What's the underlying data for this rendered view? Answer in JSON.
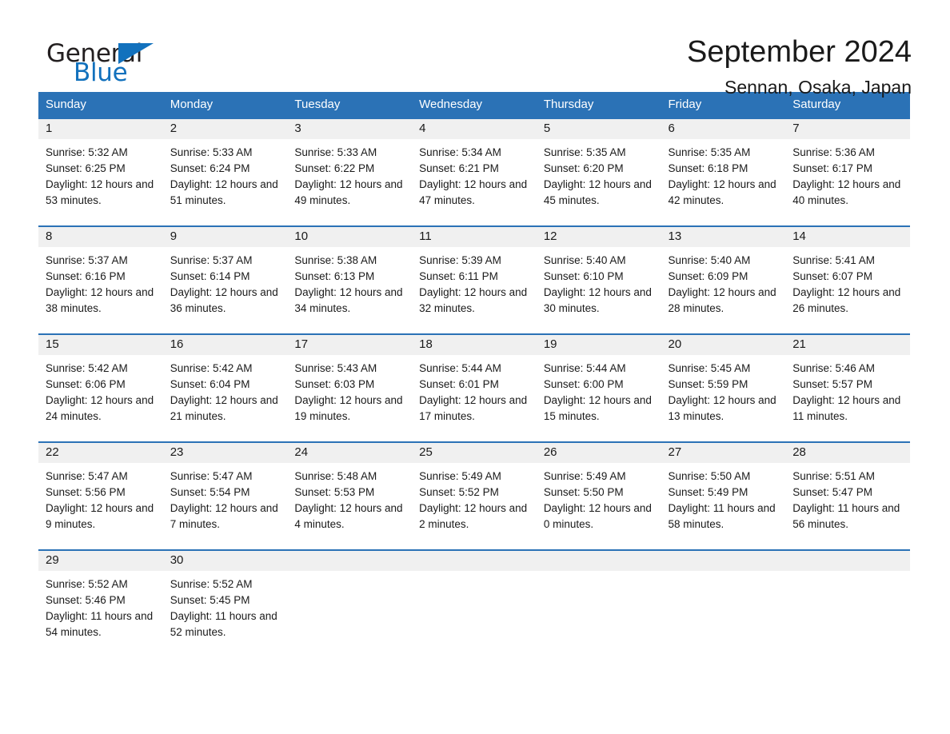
{
  "brand": {
    "name_part1": "General",
    "name_part2": "Blue",
    "triangle_color": "#1271bd"
  },
  "header": {
    "title": "September 2024",
    "subtitle": "Sennan, Osaka, Japan",
    "accent_color": "#2b72b6",
    "day_strip_color": "#f0f0f0"
  },
  "calendar": {
    "weekday_headers": [
      "Sunday",
      "Monday",
      "Tuesday",
      "Wednesday",
      "Thursday",
      "Friday",
      "Saturday"
    ],
    "weeks": [
      [
        {
          "day": "1",
          "sunrise": "Sunrise: 5:32 AM",
          "sunset": "Sunset: 6:25 PM",
          "daylight": "Daylight: 12 hours and 53 minutes."
        },
        {
          "day": "2",
          "sunrise": "Sunrise: 5:33 AM",
          "sunset": "Sunset: 6:24 PM",
          "daylight": "Daylight: 12 hours and 51 minutes."
        },
        {
          "day": "3",
          "sunrise": "Sunrise: 5:33 AM",
          "sunset": "Sunset: 6:22 PM",
          "daylight": "Daylight: 12 hours and 49 minutes."
        },
        {
          "day": "4",
          "sunrise": "Sunrise: 5:34 AM",
          "sunset": "Sunset: 6:21 PM",
          "daylight": "Daylight: 12 hours and 47 minutes."
        },
        {
          "day": "5",
          "sunrise": "Sunrise: 5:35 AM",
          "sunset": "Sunset: 6:20 PM",
          "daylight": "Daylight: 12 hours and 45 minutes."
        },
        {
          "day": "6",
          "sunrise": "Sunrise: 5:35 AM",
          "sunset": "Sunset: 6:18 PM",
          "daylight": "Daylight: 12 hours and 42 minutes."
        },
        {
          "day": "7",
          "sunrise": "Sunrise: 5:36 AM",
          "sunset": "Sunset: 6:17 PM",
          "daylight": "Daylight: 12 hours and 40 minutes."
        }
      ],
      [
        {
          "day": "8",
          "sunrise": "Sunrise: 5:37 AM",
          "sunset": "Sunset: 6:16 PM",
          "daylight": "Daylight: 12 hours and 38 minutes."
        },
        {
          "day": "9",
          "sunrise": "Sunrise: 5:37 AM",
          "sunset": "Sunset: 6:14 PM",
          "daylight": "Daylight: 12 hours and 36 minutes."
        },
        {
          "day": "10",
          "sunrise": "Sunrise: 5:38 AM",
          "sunset": "Sunset: 6:13 PM",
          "daylight": "Daylight: 12 hours and 34 minutes."
        },
        {
          "day": "11",
          "sunrise": "Sunrise: 5:39 AM",
          "sunset": "Sunset: 6:11 PM",
          "daylight": "Daylight: 12 hours and 32 minutes."
        },
        {
          "day": "12",
          "sunrise": "Sunrise: 5:40 AM",
          "sunset": "Sunset: 6:10 PM",
          "daylight": "Daylight: 12 hours and 30 minutes."
        },
        {
          "day": "13",
          "sunrise": "Sunrise: 5:40 AM",
          "sunset": "Sunset: 6:09 PM",
          "daylight": "Daylight: 12 hours and 28 minutes."
        },
        {
          "day": "14",
          "sunrise": "Sunrise: 5:41 AM",
          "sunset": "Sunset: 6:07 PM",
          "daylight": "Daylight: 12 hours and 26 minutes."
        }
      ],
      [
        {
          "day": "15",
          "sunrise": "Sunrise: 5:42 AM",
          "sunset": "Sunset: 6:06 PM",
          "daylight": "Daylight: 12 hours and 24 minutes."
        },
        {
          "day": "16",
          "sunrise": "Sunrise: 5:42 AM",
          "sunset": "Sunset: 6:04 PM",
          "daylight": "Daylight: 12 hours and 21 minutes."
        },
        {
          "day": "17",
          "sunrise": "Sunrise: 5:43 AM",
          "sunset": "Sunset: 6:03 PM",
          "daylight": "Daylight: 12 hours and 19 minutes."
        },
        {
          "day": "18",
          "sunrise": "Sunrise: 5:44 AM",
          "sunset": "Sunset: 6:01 PM",
          "daylight": "Daylight: 12 hours and 17 minutes."
        },
        {
          "day": "19",
          "sunrise": "Sunrise: 5:44 AM",
          "sunset": "Sunset: 6:00 PM",
          "daylight": "Daylight: 12 hours and 15 minutes."
        },
        {
          "day": "20",
          "sunrise": "Sunrise: 5:45 AM",
          "sunset": "Sunset: 5:59 PM",
          "daylight": "Daylight: 12 hours and 13 minutes."
        },
        {
          "day": "21",
          "sunrise": "Sunrise: 5:46 AM",
          "sunset": "Sunset: 5:57 PM",
          "daylight": "Daylight: 12 hours and 11 minutes."
        }
      ],
      [
        {
          "day": "22",
          "sunrise": "Sunrise: 5:47 AM",
          "sunset": "Sunset: 5:56 PM",
          "daylight": "Daylight: 12 hours and 9 minutes."
        },
        {
          "day": "23",
          "sunrise": "Sunrise: 5:47 AM",
          "sunset": "Sunset: 5:54 PM",
          "daylight": "Daylight: 12 hours and 7 minutes."
        },
        {
          "day": "24",
          "sunrise": "Sunrise: 5:48 AM",
          "sunset": "Sunset: 5:53 PM",
          "daylight": "Daylight: 12 hours and 4 minutes."
        },
        {
          "day": "25",
          "sunrise": "Sunrise: 5:49 AM",
          "sunset": "Sunset: 5:52 PM",
          "daylight": "Daylight: 12 hours and 2 minutes."
        },
        {
          "day": "26",
          "sunrise": "Sunrise: 5:49 AM",
          "sunset": "Sunset: 5:50 PM",
          "daylight": "Daylight: 12 hours and 0 minutes."
        },
        {
          "day": "27",
          "sunrise": "Sunrise: 5:50 AM",
          "sunset": "Sunset: 5:49 PM",
          "daylight": "Daylight: 11 hours and 58 minutes."
        },
        {
          "day": "28",
          "sunrise": "Sunrise: 5:51 AM",
          "sunset": "Sunset: 5:47 PM",
          "daylight": "Daylight: 11 hours and 56 minutes."
        }
      ],
      [
        {
          "day": "29",
          "sunrise": "Sunrise: 5:52 AM",
          "sunset": "Sunset: 5:46 PM",
          "daylight": "Daylight: 11 hours and 54 minutes."
        },
        {
          "day": "30",
          "sunrise": "Sunrise: 5:52 AM",
          "sunset": "Sunset: 5:45 PM",
          "daylight": "Daylight: 11 hours and 52 minutes."
        },
        {
          "day": "",
          "sunrise": "",
          "sunset": "",
          "daylight": ""
        },
        {
          "day": "",
          "sunrise": "",
          "sunset": "",
          "daylight": ""
        },
        {
          "day": "",
          "sunrise": "",
          "sunset": "",
          "daylight": ""
        },
        {
          "day": "",
          "sunrise": "",
          "sunset": "",
          "daylight": ""
        },
        {
          "day": "",
          "sunrise": "",
          "sunset": "",
          "daylight": ""
        }
      ]
    ]
  }
}
